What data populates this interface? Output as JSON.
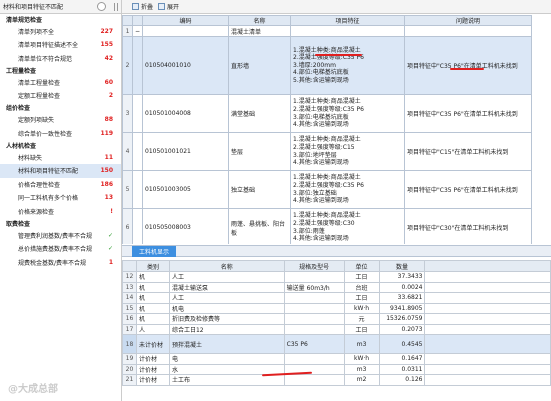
{
  "left_panel": {
    "title": "材料和项目特征不匹配",
    "sections": [
      {
        "label": "清单规范检查",
        "items": [
          {
            "label": "清单列项不全",
            "count": "227"
          },
          {
            "label": "清单项目特征描述不全",
            "count": "155"
          },
          {
            "label": "清单单位不符合规范",
            "count": "42"
          }
        ]
      },
      {
        "label": "工程量检查",
        "items": [
          {
            "label": "清单工程量检查",
            "count": "60"
          },
          {
            "label": "定额工程量检查",
            "count": "2"
          }
        ]
      },
      {
        "label": "组价检查",
        "items": [
          {
            "label": "定额列项缺失",
            "count": "88"
          },
          {
            "label": "综合单价一致性检查",
            "count": "119"
          }
        ]
      },
      {
        "label": "人材机检查",
        "items": [
          {
            "label": "材料缺失",
            "count": "11"
          },
          {
            "label": "材料和项目特征不匹配",
            "count": "150",
            "selected": true
          },
          {
            "label": "价格合理性检查",
            "count": "186"
          },
          {
            "label": "同一工料机有多个价格",
            "count": "13"
          },
          {
            "label": "价格来源检查",
            "count": "!"
          }
        ]
      },
      {
        "label": "取费检查",
        "items": [
          {
            "label": "管理费利润基数/费率不合规",
            "count": "✓"
          },
          {
            "label": "总价措施费基数/费率不合规",
            "count": "✓"
          },
          {
            "label": "规费税金基数/费率不合规",
            "count": "1"
          }
        ]
      }
    ]
  },
  "toolbar": {
    "fold": "折叠",
    "expand": "展开"
  },
  "upper_table": {
    "headers": [
      "编码",
      "名称",
      "项目特征",
      "问题说明"
    ],
    "rows": [
      {
        "no": "1",
        "code": "",
        "name": "混凝土清单",
        "feature": "",
        "issue": "",
        "group": true
      },
      {
        "no": "2",
        "code": "010504001010",
        "name": "直形墙",
        "feature": "1.混凝土种类:商品混凝土\n2.混凝土强度等级:C35 P6\n3.墙厚:200mm\n4.部位:电梯基坑底板\n5.其他:含运输到现场",
        "issue": "项目特征中\"C35 P6\"在清单工料机未找到",
        "selected": true
      },
      {
        "no": "3",
        "code": "010501004008",
        "name": "满堂基础",
        "feature": "1.混凝土种类:商品混凝土\n2.混凝土强度等级:C35 P6\n3.部位:电梯基坑底板\n4.其他:含运输到现场",
        "issue": "项目特征中\"C35 P6\"在清单工料机未找到"
      },
      {
        "no": "4",
        "code": "010501001021",
        "name": "垫层",
        "feature": "1.混凝土种类:商品混凝土\n2.混凝土强度等级:C15\n3.部位:地坪垫层\n4.其他:含运输到现场",
        "issue": "项目特征中\"C15\"在清单工料机未找到"
      },
      {
        "no": "5",
        "code": "010501003005",
        "name": "独立基础",
        "feature": "1.混凝土种类:商品混凝土\n2.混凝土强度等级:C35 P6\n3.部位:独立基础\n4.其他:含运输到现场",
        "issue": "项目特征中\"C35 P6\"在清单工料机未找到"
      },
      {
        "no": "6",
        "code": "010505008003",
        "name": "雨蓬、悬挑板、阳台板",
        "feature": "1.混凝土种类:商品混凝土\n2.混凝土强度等级:C30\n3.部位:雨蓬\n4.其他:含运输到现场",
        "issue": "项目特征中\"C30\"在清单工料机未找到"
      },
      {
        "no": "7",
        "code": "010501003003",
        "name": "独立基础",
        "feature": "1.混凝土种类:商品混凝土\n2.混凝土强度等级:C35 P6\n3.部位:独立基础\n4.其他:含运输到现场",
        "issue": "项目特征中\"C35 P6\"在清单工料机未找到"
      }
    ]
  },
  "lower_tab": "工料机显示",
  "lower_table": {
    "headers": [
      "类别",
      "名称",
      "规格及型号",
      "单位",
      "数量"
    ],
    "rows": [
      {
        "no": "12",
        "cat": "机",
        "name": "人工",
        "spec": "",
        "unit": "工日",
        "qty": "37.3433"
      },
      {
        "no": "13",
        "cat": "机",
        "name": "混凝土输送泵",
        "spec": "输送量 60m3/h",
        "unit": "台班",
        "qty": "0.0024"
      },
      {
        "no": "14",
        "cat": "机",
        "name": "人工",
        "spec": "",
        "unit": "工日",
        "qty": "33.6821"
      },
      {
        "no": "15",
        "cat": "机",
        "name": "机电",
        "spec": "",
        "unit": "kW·h",
        "qty": "9341.8905"
      },
      {
        "no": "16",
        "cat": "机",
        "name": "折旧费及检修费等",
        "spec": "",
        "unit": "元",
        "qty": "15326.0759"
      },
      {
        "no": "17",
        "cat": "人",
        "name": "综合工日12",
        "spec": "",
        "unit": "工日",
        "qty": "0.2073"
      },
      {
        "no": "18",
        "cat": "未计价材",
        "name": "预拌混凝土",
        "spec": "C35 P6",
        "unit": "m3",
        "qty": "0.4545",
        "highlight": true
      },
      {
        "no": "19",
        "cat": "计价材",
        "name": "电",
        "spec": "",
        "unit": "kW·h",
        "qty": "0.1647"
      },
      {
        "no": "20",
        "cat": "计价材",
        "name": "水",
        "spec": "",
        "unit": "m3",
        "qty": "0.0311"
      },
      {
        "no": "21",
        "cat": "计价材",
        "name": "土工布",
        "spec": "",
        "unit": "m2",
        "qty": "0.126"
      }
    ]
  },
  "watermark": "@大成总部"
}
